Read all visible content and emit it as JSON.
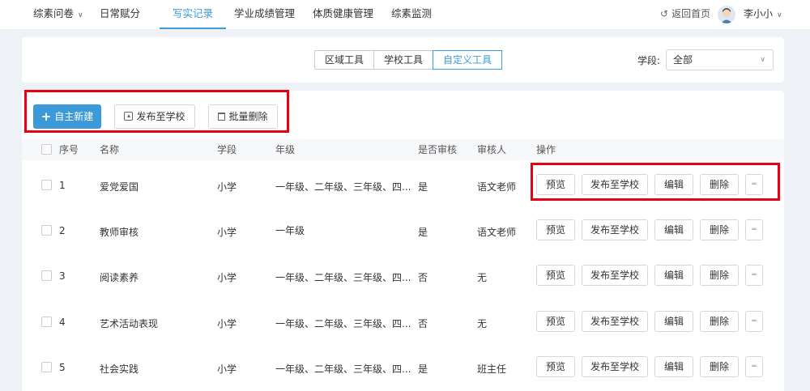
{
  "nav": {
    "items": [
      {
        "label": "综素问卷"
      },
      {
        "label": "日常赋分"
      },
      {
        "label": "写实记录"
      },
      {
        "label": "学业成绩管理"
      },
      {
        "label": "体质健康管理"
      },
      {
        "label": "综素监测"
      }
    ],
    "back_home": "返回首页",
    "user_name": "李小小"
  },
  "filter": {
    "tools": [
      "区域工具",
      "学校工具",
      "自定义工具"
    ],
    "stage_label": "学段:",
    "stage_value": "全部"
  },
  "actions": {
    "create": "自主新建",
    "publish": "发布至学校",
    "batch_delete": "批量删除"
  },
  "table": {
    "headers": {
      "index": "序号",
      "name": "名称",
      "stage": "学段",
      "grade": "年级",
      "review": "是否审核",
      "reviewer": "审核人",
      "ops": "操作"
    },
    "op_labels": {
      "preview": "预览",
      "publish": "发布至学校",
      "edit": "编辑",
      "delete": "删除",
      "more": "═"
    },
    "rows": [
      {
        "index": "1",
        "name": "爱党爱国",
        "stage": "小学",
        "grade": "一年级、二年级、三年级、四...",
        "review": "是",
        "reviewer": "语文老师"
      },
      {
        "index": "2",
        "name": "教师审核",
        "stage": "小学",
        "grade": "一年级",
        "review": "是",
        "reviewer": "语文老师"
      },
      {
        "index": "3",
        "name": "阅读素养",
        "stage": "小学",
        "grade": "一年级、二年级、三年级、四...",
        "review": "否",
        "reviewer": "无"
      },
      {
        "index": "4",
        "name": "艺术活动表现",
        "stage": "小学",
        "grade": "一年级、二年级、三年级、四...",
        "review": "否",
        "reviewer": "无"
      },
      {
        "index": "5",
        "name": "社会实践",
        "stage": "小学",
        "grade": "一年级、二年级、三年级、四...",
        "review": "是",
        "reviewer": "班主任"
      }
    ]
  }
}
